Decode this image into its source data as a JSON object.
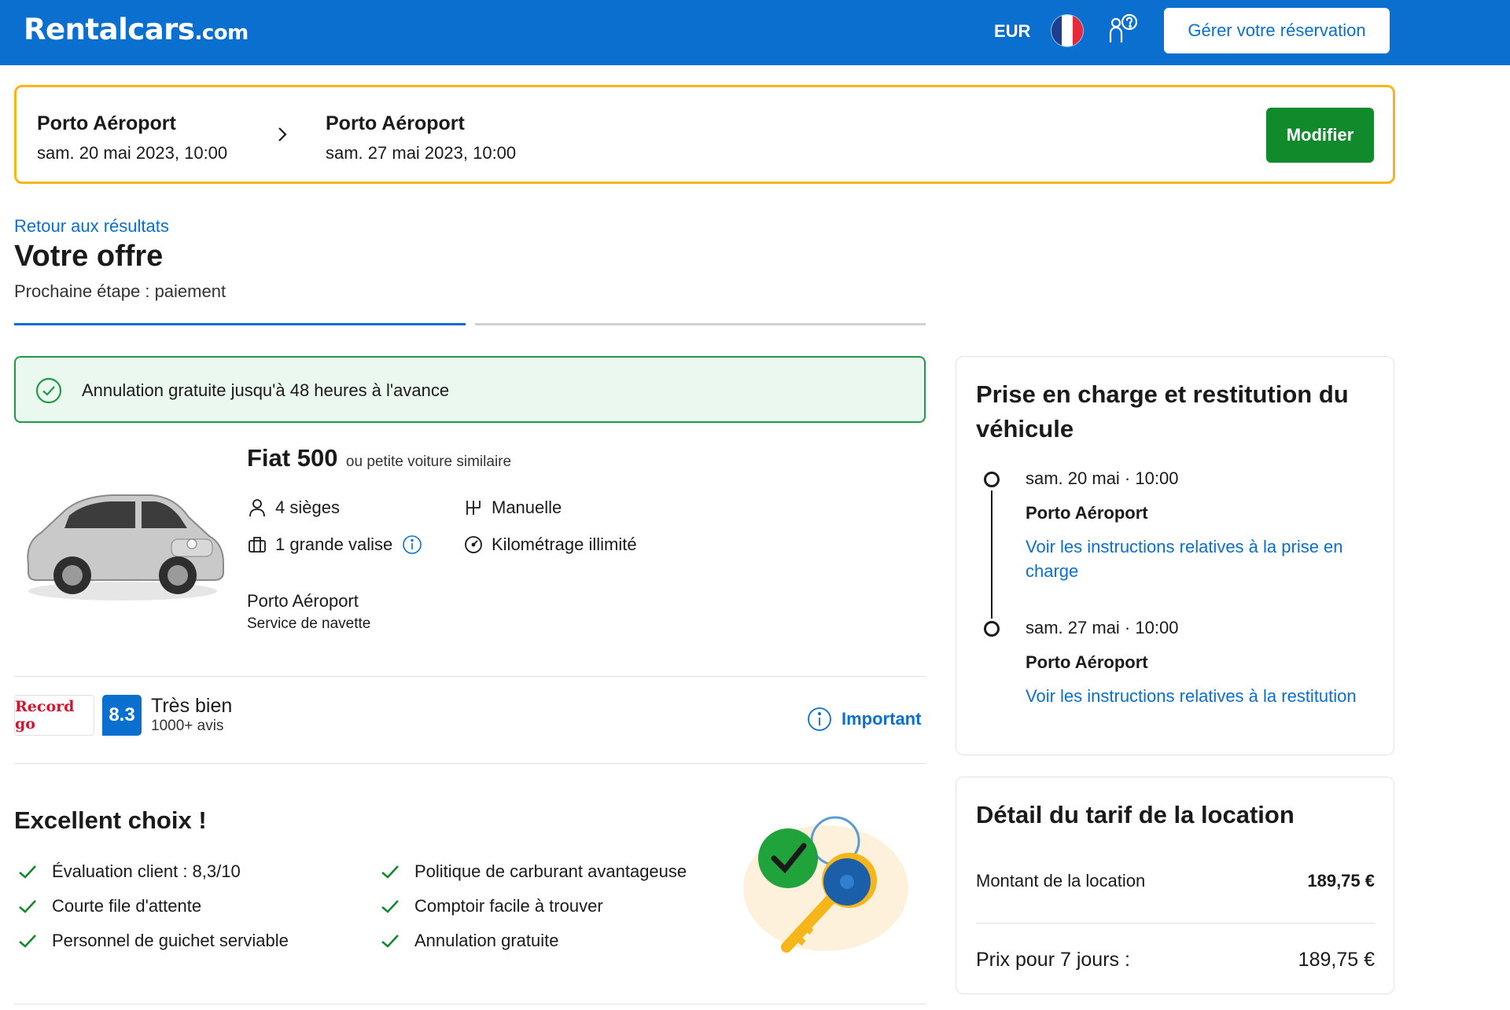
{
  "header": {
    "logo_main": "Rentalcars",
    "logo_suffix": ".com",
    "currency": "EUR",
    "manage_label": "Gérer votre réservation",
    "brand_color": "#0a6fcf"
  },
  "search_summary": {
    "pickup_name": "Porto Aéroport",
    "pickup_date": "sam. 20 mai 2023, 10:00",
    "dropoff_name": "Porto Aéroport",
    "dropoff_date": "sam. 27 mai 2023, 10:00",
    "modify_label": "Modifier"
  },
  "page": {
    "back_link": "Retour aux résultats",
    "title": "Votre offre",
    "next_step": "Prochaine étape : paiement"
  },
  "cancellation_banner": "Annulation gratuite jusqu'à 48 heures à l'avance",
  "car": {
    "model": "Fiat 500",
    "similar": "ou petite voiture similaire",
    "seats": "4 sièges",
    "luggage": "1 grande valise",
    "transmission": "Manuelle",
    "mileage": "Kilométrage illimité",
    "location": "Porto Aéroport",
    "shuttle": "Service de navette"
  },
  "supplier": {
    "logo_text": "Record go",
    "score": "8.3",
    "rating_label": "Très bien",
    "review_count": "1000+ avis",
    "important_label": "Important"
  },
  "excellent": {
    "title": "Excellent choix !",
    "features": [
      "Évaluation client : 8,3/10",
      "Courte file d'attente",
      "Personnel de guichet serviable",
      "Politique de carburant avantageuse",
      "Comptoir facile à trouver",
      "Annulation gratuite"
    ]
  },
  "pickup_card": {
    "title": "Prise en charge et restitution du véhicule",
    "pickup_datetime": "sam. 20 mai · 10:00",
    "pickup_place": "Porto Aéroport",
    "pickup_link": "Voir les instructions relatives à la prise en charge",
    "return_datetime": "sam. 27 mai · 10:00",
    "return_place": "Porto Aéroport",
    "return_link": "Voir les instructions relatives à la restitution"
  },
  "price_card": {
    "title": "Détail du tarif de la location",
    "rental_label": "Montant de la location",
    "rental_value": "189,75 €",
    "total_label": "Prix pour 7 jours :",
    "total_value": "189,75 €"
  },
  "icons": [
    "help-icon",
    "chevron-right-icon",
    "check-circle-icon",
    "person-icon",
    "suitcase-icon",
    "info-icon",
    "gearshift-icon",
    "speedometer-icon",
    "check-icon",
    "keys-illustration"
  ],
  "colors": {
    "accent_blue": "#0a6fcf",
    "summary_border": "#f6b619",
    "modify_green": "#118a2c",
    "banner_green": "#1f9b46",
    "banner_bg": "#ebf8ef"
  }
}
